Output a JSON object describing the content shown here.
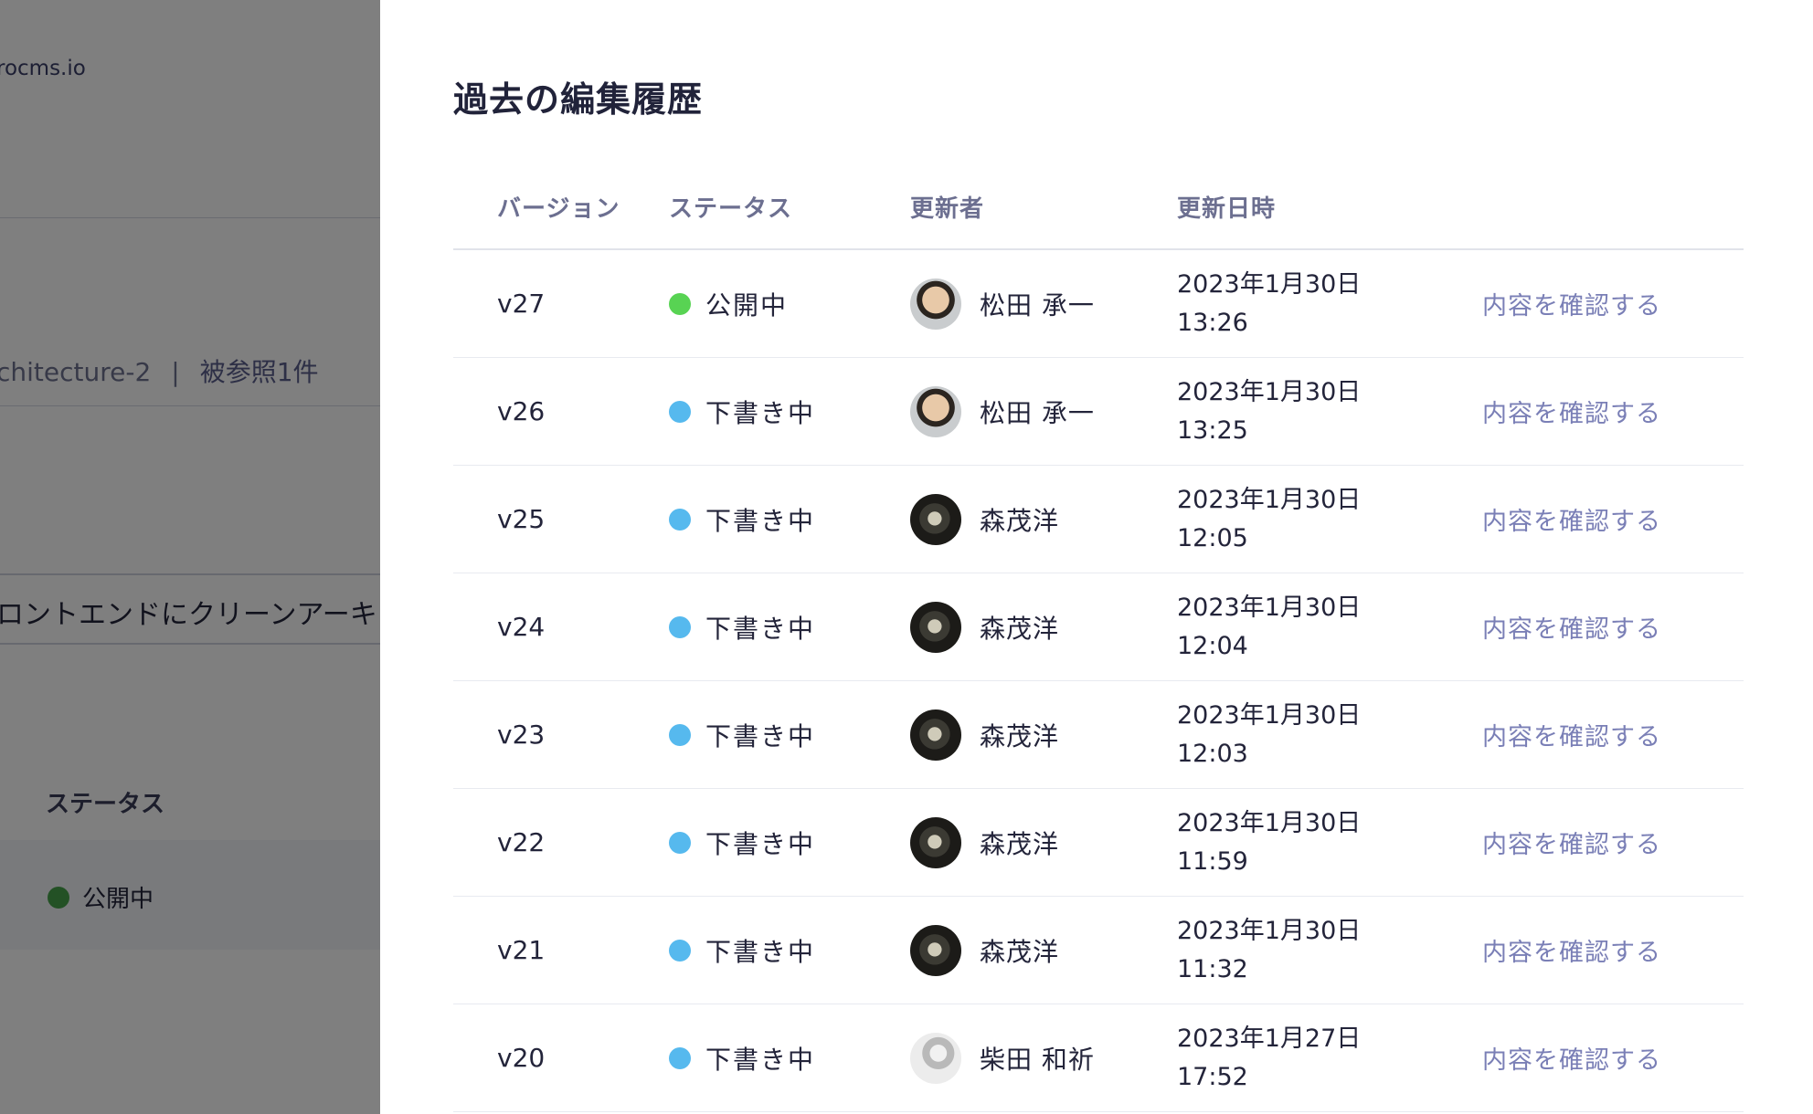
{
  "background": {
    "domain_text": "rocms.io",
    "meta_text": "chitecture-2",
    "meta_separator": "|",
    "reference_text": "被参照1件",
    "input_value": "ロントエンドにクリーンアーキ",
    "status_label": "ステータス",
    "status_value": "公開中",
    "colors": {
      "published_dot": "#47a34a"
    }
  },
  "drawer": {
    "title": "過去の編集履歴",
    "columns": {
      "version": "バージョン",
      "status": "ステータス",
      "updater": "更新者",
      "updated_at": "更新日時"
    },
    "colors": {
      "published": "#58d353",
      "draft": "#56b9ee",
      "link": "#7a7fb6"
    },
    "rows": [
      {
        "version": "v27",
        "status": "公開中",
        "status_type": "published",
        "avatar": "avatar-a",
        "user": "松田 承一",
        "date": "2023年1月30日",
        "time": "13:26",
        "action": "内容を確認する"
      },
      {
        "version": "v26",
        "status": "下書き中",
        "status_type": "draft",
        "avatar": "avatar-a",
        "user": "松田 承一",
        "date": "2023年1月30日",
        "time": "13:25",
        "action": "内容を確認する"
      },
      {
        "version": "v25",
        "status": "下書き中",
        "status_type": "draft",
        "avatar": "avatar-b",
        "user": "森茂洋",
        "date": "2023年1月30日",
        "time": "12:05",
        "action": "内容を確認する"
      },
      {
        "version": "v24",
        "status": "下書き中",
        "status_type": "draft",
        "avatar": "avatar-b",
        "user": "森茂洋",
        "date": "2023年1月30日",
        "time": "12:04",
        "action": "内容を確認する"
      },
      {
        "version": "v23",
        "status": "下書き中",
        "status_type": "draft",
        "avatar": "avatar-b",
        "user": "森茂洋",
        "date": "2023年1月30日",
        "time": "12:03",
        "action": "内容を確認する"
      },
      {
        "version": "v22",
        "status": "下書き中",
        "status_type": "draft",
        "avatar": "avatar-b",
        "user": "森茂洋",
        "date": "2023年1月30日",
        "time": "11:59",
        "action": "内容を確認する"
      },
      {
        "version": "v21",
        "status": "下書き中",
        "status_type": "draft",
        "avatar": "avatar-b",
        "user": "森茂洋",
        "date": "2023年1月30日",
        "time": "11:32",
        "action": "内容を確認する"
      },
      {
        "version": "v20",
        "status": "下書き中",
        "status_type": "draft",
        "avatar": "avatar-c",
        "user": "柴田 和祈",
        "date": "2023年1月27日",
        "time": "17:52",
        "action": "内容を確認する"
      }
    ]
  }
}
